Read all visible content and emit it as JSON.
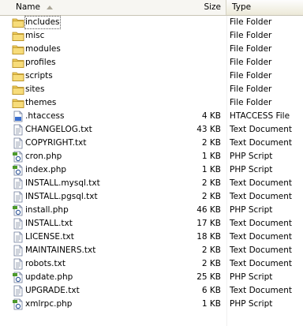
{
  "columns": {
    "name": "Name",
    "size": "Size",
    "type": "Type"
  },
  "files": [
    {
      "name": "includes",
      "size": "",
      "type": "File Folder",
      "icon": "folder-icon"
    },
    {
      "name": "misc",
      "size": "",
      "type": "File Folder",
      "icon": "folder-icon"
    },
    {
      "name": "modules",
      "size": "",
      "type": "File Folder",
      "icon": "folder-icon"
    },
    {
      "name": "profiles",
      "size": "",
      "type": "File Folder",
      "icon": "folder-icon"
    },
    {
      "name": "scripts",
      "size": "",
      "type": "File Folder",
      "icon": "folder-icon"
    },
    {
      "name": "sites",
      "size": "",
      "type": "File Folder",
      "icon": "folder-icon"
    },
    {
      "name": "themes",
      "size": "",
      "type": "File Folder",
      "icon": "folder-icon"
    },
    {
      "name": ".htaccess",
      "size": "4 KB",
      "type": "HTACCESS File",
      "icon": "generic-file-icon"
    },
    {
      "name": "CHANGELOG.txt",
      "size": "43 KB",
      "type": "Text Document",
      "icon": "text-document-icon"
    },
    {
      "name": "COPYRIGHT.txt",
      "size": "2 KB",
      "type": "Text Document",
      "icon": "text-document-icon"
    },
    {
      "name": "cron.php",
      "size": "1 KB",
      "type": "PHP Script",
      "icon": "php-script-icon"
    },
    {
      "name": "index.php",
      "size": "1 KB",
      "type": "PHP Script",
      "icon": "php-script-icon"
    },
    {
      "name": "INSTALL.mysql.txt",
      "size": "2 KB",
      "type": "Text Document",
      "icon": "text-document-icon"
    },
    {
      "name": "INSTALL.pgsql.txt",
      "size": "2 KB",
      "type": "Text Document",
      "icon": "text-document-icon"
    },
    {
      "name": "install.php",
      "size": "46 KB",
      "type": "PHP Script",
      "icon": "php-script-icon"
    },
    {
      "name": "INSTALL.txt",
      "size": "17 KB",
      "type": "Text Document",
      "icon": "text-document-icon"
    },
    {
      "name": "LICENSE.txt",
      "size": "18 KB",
      "type": "Text Document",
      "icon": "text-document-icon"
    },
    {
      "name": "MAINTAINERS.txt",
      "size": "2 KB",
      "type": "Text Document",
      "icon": "text-document-icon"
    },
    {
      "name": "robots.txt",
      "size": "2 KB",
      "type": "Text Document",
      "icon": "text-document-icon"
    },
    {
      "name": "update.php",
      "size": "25 KB",
      "type": "PHP Script",
      "icon": "php-script-icon"
    },
    {
      "name": "UPGRADE.txt",
      "size": "6 KB",
      "type": "Text Document",
      "icon": "text-document-icon"
    },
    {
      "name": "xmlrpc.php",
      "size": "1 KB",
      "type": "PHP Script",
      "icon": "php-script-icon"
    }
  ],
  "selected_index": 0,
  "colors": {
    "folder": "#f0cf5c",
    "php_badge": "#4c9a2a",
    "header_bg": "#ece9d8"
  }
}
